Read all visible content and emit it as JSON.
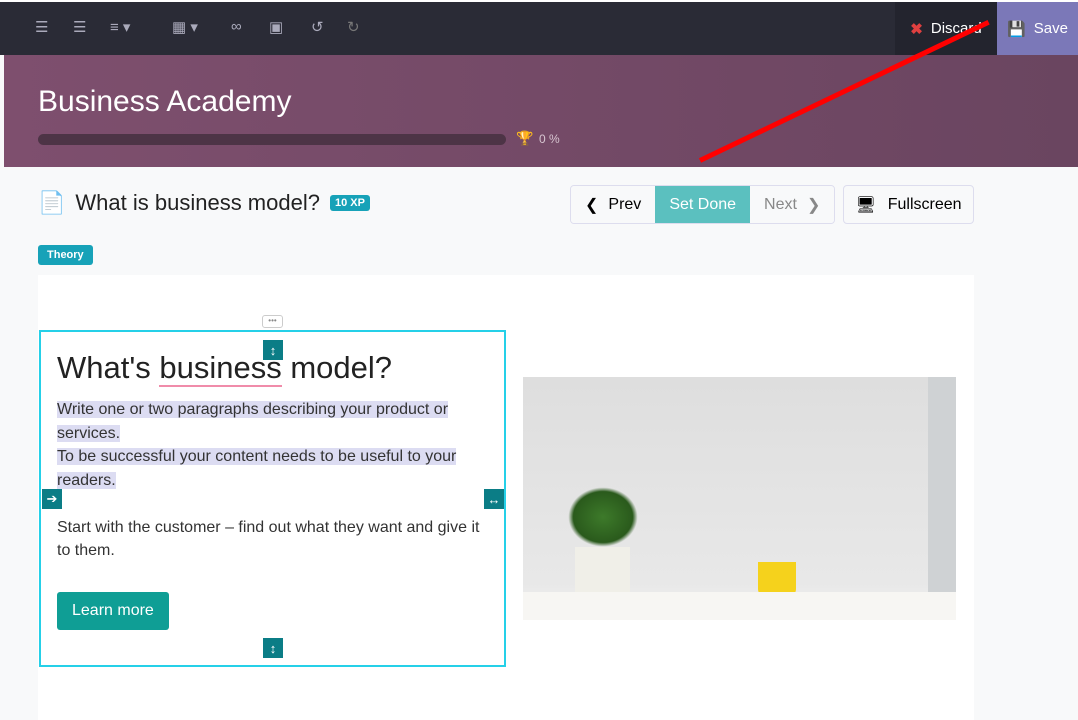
{
  "toolbar": {
    "icons": [
      "unordered-list-icon",
      "ordered-list-icon",
      "align-icon",
      "table-icon",
      "link-icon",
      "image-icon",
      "undo-icon",
      "redo-icon"
    ],
    "discard": "Discard",
    "save": "Save"
  },
  "course": {
    "title": "Business Academy",
    "progress_pct": 0,
    "progress_label": "0 %"
  },
  "lesson": {
    "title": "What is business model?",
    "xp": "10 XP",
    "tag": "Theory",
    "prev": "Prev",
    "set_done": "Set Done",
    "next": "Next",
    "fullscreen": "Fullscreen"
  },
  "block": {
    "heading_pre": "What's ",
    "heading_word": "business",
    "heading_post": " model?",
    "p1": "Write one or two paragraphs describing your product or services.",
    "p2": "To be successful your content needs to be useful to your readers.",
    "p3": "Start with the customer – find out what they want and give it to them.",
    "button": "Learn more"
  },
  "colors": {
    "banner": "#7e4f6e",
    "accent": "#17a2b8",
    "save": "#7b78b8",
    "annotation_arrow": "#ff0000"
  }
}
